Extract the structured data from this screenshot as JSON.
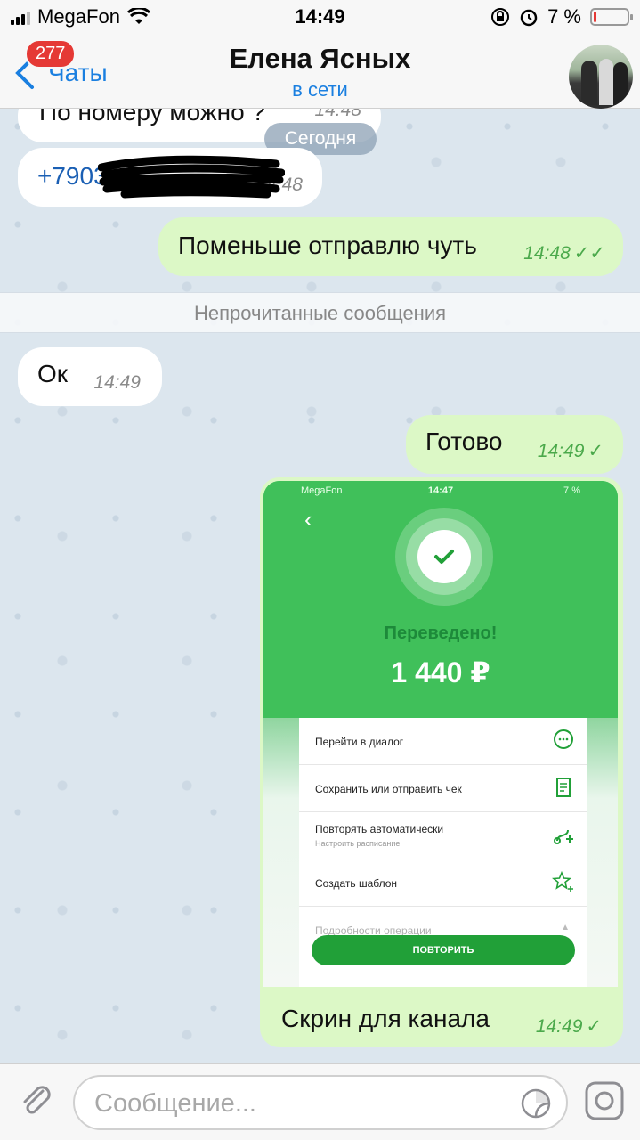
{
  "status_bar": {
    "carrier": "MegaFon",
    "time": "14:49",
    "battery_percent": "7 %",
    "battery_level": 0.07
  },
  "header": {
    "back_label": "Чаты",
    "unread_count": "277",
    "title": "Елена Ясных",
    "status": "в сети"
  },
  "messages": [
    {
      "direction": "in",
      "text": "По номеру можно ?",
      "time": "14:48"
    },
    {
      "direction": "in",
      "text": "+7903",
      "time": "14:48",
      "redacted": true
    },
    {
      "direction": "out",
      "text": "Поменьше отправлю чуть",
      "time": "14:48",
      "status": "read"
    },
    {
      "direction": "in",
      "text": "Ок",
      "time": "14:49"
    },
    {
      "direction": "out",
      "text": "Готово",
      "time": "14:49",
      "status": "sent"
    },
    {
      "direction": "out",
      "text": "Скрин для канала",
      "time": "14:49",
      "status": "sent"
    }
  ],
  "date_separator": "Сегодня",
  "unread_separator": "Непрочитанные сообщения",
  "embedded_screenshot": {
    "status_bar": {
      "carrier": "MegaFon",
      "time": "14:47",
      "battery": "7 %"
    },
    "title": "Переведено!",
    "amount": "1 440 ₽",
    "actions": [
      {
        "label": "Перейти в диалог",
        "icon": "chat-bubble-icon"
      },
      {
        "label": "Сохранить или отправить чек",
        "icon": "receipt-icon"
      },
      {
        "label": "Повторять автоматически",
        "sublabel": "Настроить расписание",
        "icon": "repeat-plus-icon"
      },
      {
        "label": "Создать шаблон",
        "icon": "star-plus-icon"
      },
      {
        "label": "Подробности операции",
        "icon": "chevron-up-icon"
      }
    ],
    "repeat_button": "ПОВТОРИТЬ",
    "accent_color": "#40c05a",
    "button_color": "#21a038"
  },
  "input": {
    "placeholder": "Сообщение..."
  },
  "colors": {
    "accent": "#1a7fe0",
    "outgoing_bubble": "#dcf8c6",
    "incoming_bubble": "#ffffff",
    "badge": "#e53935"
  }
}
